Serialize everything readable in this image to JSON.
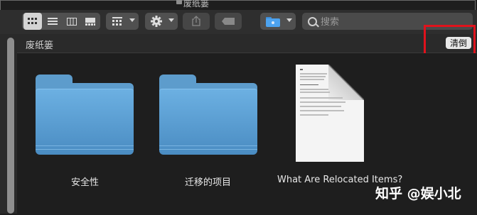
{
  "window": {
    "title": "废纸篓"
  },
  "toolbar": {
    "view_buttons": [
      "icon-view",
      "list-view",
      "column-view",
      "gallery-view"
    ],
    "group_button": "group-by",
    "action_button": "gear",
    "share_button": "share",
    "tag_button": "tag",
    "folder_button": "folder"
  },
  "search": {
    "placeholder": "搜索"
  },
  "pathbar": {
    "title": "废纸篓",
    "empty_button": "清倒"
  },
  "items": [
    {
      "label": "安全性",
      "type": "folder"
    },
    {
      "label": "迁移的项目",
      "type": "folder"
    },
    {
      "label": "What Are Relocated Items?",
      "type": "document"
    }
  ],
  "watermark": "知乎 @娱小北",
  "colors": {
    "highlight": "#e0121c",
    "folder": "#5d9ccc",
    "background": "#1e1e1e"
  }
}
